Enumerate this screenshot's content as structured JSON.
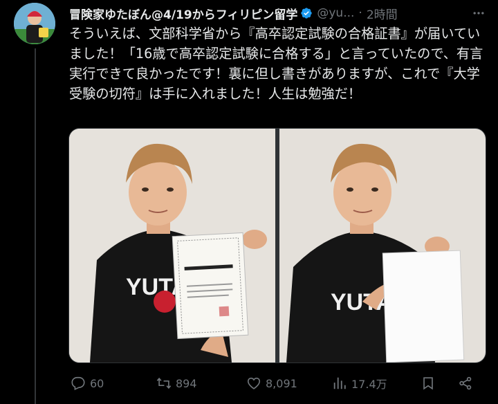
{
  "author": {
    "display_name": "冒険家ゆたぼん@4/19からフィリピン留学",
    "handle": "@yu...",
    "separator": "·",
    "time": "2時間",
    "verified": true
  },
  "tweet": {
    "text": "そういえば、文部科学省から『高卒認定試験の合格証書』が届いていました！「16歳で高卒認定試験に合格する」と言っていたので、有言実行できて良かったです！裏に但し書きがありますが、これで『大学受験の切符』は手に入れました！人生は勉強だ！"
  },
  "media": {
    "photo_left_shirt_text": "YUTA",
    "photo_right_shirt_text": "YUTA"
  },
  "actions": {
    "replies": "60",
    "retweets": "894",
    "likes": "8,091",
    "views": "17.4万"
  },
  "icons": [
    "verified-icon",
    "more-icon",
    "reply-icon",
    "retweet-icon",
    "like-icon",
    "views-icon",
    "bookmark-icon",
    "share-icon"
  ],
  "colors": {
    "background": "#000000",
    "text": "#e7e9ea",
    "muted": "#71767b",
    "verified": "#1d9bf0"
  }
}
